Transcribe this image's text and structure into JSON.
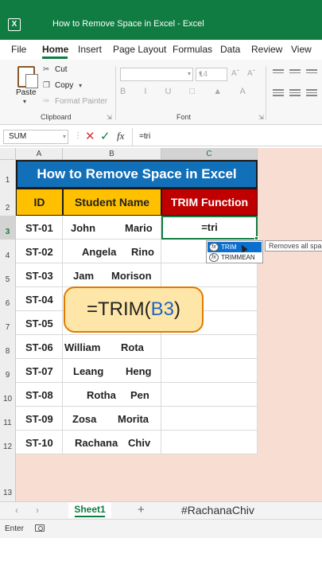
{
  "window": {
    "app_icon": "excel-icon",
    "app_letter": "X",
    "title": "How to Remove Space in Excel  -  Excel"
  },
  "ribbon_tabs": [
    "File",
    "Home",
    "Insert",
    "Page Layout",
    "Formulas",
    "Data",
    "Review",
    "View"
  ],
  "active_tab": "Home",
  "clipboard": {
    "paste_label": "Paste",
    "cut_label": "Cut",
    "copy_label": "Copy",
    "format_painter_label": "Format Painter",
    "group_label": "Clipboard"
  },
  "font_group": {
    "font_name": "",
    "font_size": "14",
    "group_label": "Font"
  },
  "formula_bar": {
    "name_box": "SUM",
    "formula": "=tri",
    "fx_label": "fx"
  },
  "columns": [
    "A",
    "B",
    "C"
  ],
  "rows": [
    "1",
    "2",
    "3",
    "4",
    "5",
    "6",
    "7",
    "8",
    "9",
    "10",
    "11",
    "12",
    "13"
  ],
  "sheet": {
    "title": "How to Remove Space in Excel",
    "headers": {
      "id": "ID",
      "name": "Student Name",
      "trim": "TRIM Function"
    },
    "students": [
      {
        "id": "ST-01",
        "first": "John",
        "last": "Mario"
      },
      {
        "id": "ST-02",
        "first": "Angela",
        "last": "Rino"
      },
      {
        "id": "ST-03",
        "first": "Jam",
        "last": "Morison"
      },
      {
        "id": "ST-04",
        "first": "",
        "last": ""
      },
      {
        "id": "ST-05",
        "first": "",
        "last": ""
      },
      {
        "id": "ST-06",
        "first": "William",
        "last": "Rota"
      },
      {
        "id": "ST-07",
        "first": "Leang",
        "last": "Heng"
      },
      {
        "id": "ST-08",
        "first": "Rotha",
        "last": "Pen"
      },
      {
        "id": "ST-09",
        "first": "Zosa",
        "last": "Morita"
      },
      {
        "id": "ST-10",
        "first": "Rachana",
        "last": "Chiv"
      }
    ],
    "active_cell_value": "=tri"
  },
  "autocomplete": {
    "items": [
      "TRIM",
      "TRIMMEAN"
    ],
    "selected": "TRIM",
    "tooltip": "Removes all spaces from"
  },
  "callout": {
    "fn": "=TRIM(",
    "ref": "B3",
    "close": ")"
  },
  "sheet_tabs": {
    "active": "Sheet1",
    "hashtag": "#RachanaChiv"
  },
  "status": {
    "mode": "Enter"
  },
  "colors": {
    "excel_green": "#107c41",
    "title_blue": "#1270b9",
    "header_yellow": "#ffc000",
    "header_red": "#c00000",
    "callout_fill": "#fde6a7",
    "callout_border": "#e07b00",
    "reference_blue": "#1f64c7",
    "background_peach": "#f8ddd2"
  }
}
